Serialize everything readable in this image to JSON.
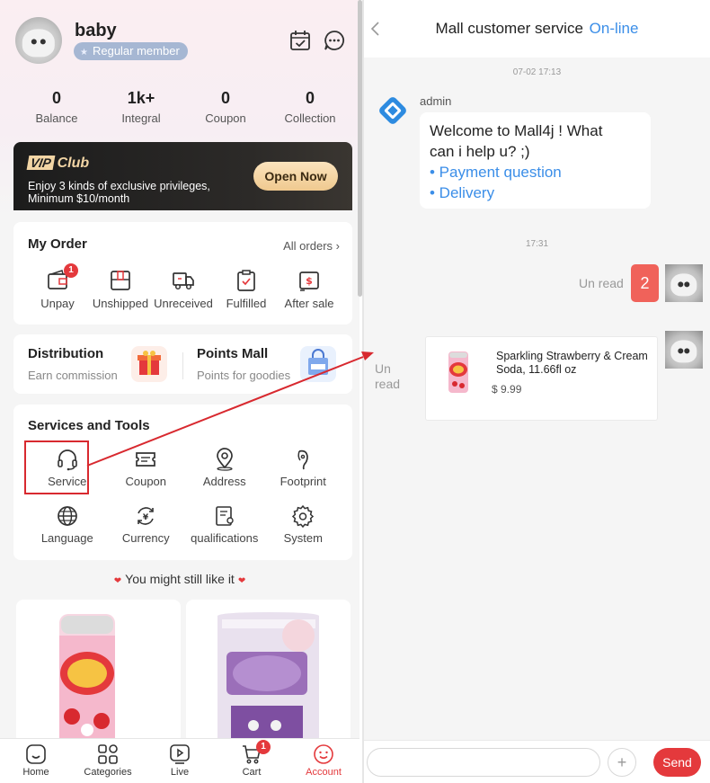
{
  "profile": {
    "username": "baby",
    "member_level": "Regular member"
  },
  "stats": [
    {
      "value": "0",
      "label": "Balance"
    },
    {
      "value": "1k+",
      "label": "Integral"
    },
    {
      "value": "0",
      "label": "Coupon"
    },
    {
      "value": "0",
      "label": "Collection"
    }
  ],
  "vip": {
    "badge": "VIP",
    "title": "Club",
    "desc_line1": "Enjoy 3 kinds of exclusive privileges,",
    "desc_line2": "Minimum $10/month",
    "button": "Open Now"
  },
  "orders": {
    "title": "My Order",
    "all_label": "All orders",
    "items": [
      {
        "label": "Unpay",
        "icon": "wallet-icon",
        "badge": "1"
      },
      {
        "label": "Unshipped",
        "icon": "package-icon"
      },
      {
        "label": "Unreceived",
        "icon": "truck-icon"
      },
      {
        "label": "Fulfilled",
        "icon": "clipboard-check-icon"
      },
      {
        "label": "After sale",
        "icon": "refund-icon"
      }
    ]
  },
  "promo": {
    "distribution": {
      "title": "Distribution",
      "sub": "Earn commission"
    },
    "points": {
      "title": "Points Mall",
      "sub": "Points for goodies"
    }
  },
  "tools": {
    "title": "Services and Tools",
    "items": [
      {
        "label": "Service",
        "icon": "headset-icon"
      },
      {
        "label": "Coupon",
        "icon": "ticket-icon"
      },
      {
        "label": "Address",
        "icon": "location-pin-icon"
      },
      {
        "label": "Footprint",
        "icon": "footprint-icon"
      },
      {
        "label": "Language",
        "icon": "globe-icon"
      },
      {
        "label": "Currency",
        "icon": "currency-exchange-icon"
      },
      {
        "label": "qualifications",
        "icon": "certificate-icon"
      },
      {
        "label": "System",
        "icon": "gear-icon"
      }
    ]
  },
  "recommend": {
    "title": "You might still like it"
  },
  "tabbar": [
    {
      "label": "Home",
      "icon": "home-icon"
    },
    {
      "label": "Categories",
      "icon": "categories-icon"
    },
    {
      "label": "Live",
      "icon": "live-icon"
    },
    {
      "label": "Cart",
      "icon": "cart-icon",
      "badge": "1"
    },
    {
      "label": "Account",
      "icon": "account-icon",
      "active": true
    }
  ],
  "chat": {
    "title": "Mall customer service",
    "status": "On-line",
    "timestamp1": "07-02 17:13",
    "admin_name": "admin",
    "welcome_line1": "Welcome to Mall4j ! What",
    "welcome_line2": "can i help u? ;)",
    "option1": "• Payment question",
    "option2": "• Delivery",
    "timestamp2": "17:31",
    "unread1": "Un read",
    "number_message": "2",
    "unread2_line1": "Un",
    "unread2_line2": "read",
    "product_name": "Sparkling Strawberry & Cream Soda, 11.66fl oz",
    "product_price": "$ 9.99",
    "send_label": "Send",
    "plus_label": "+"
  },
  "colors": {
    "accent_red": "#e4393c",
    "link_blue": "#3b8ee8",
    "vip_gold": "#f2d5a5",
    "highlight": "#d8292f"
  }
}
